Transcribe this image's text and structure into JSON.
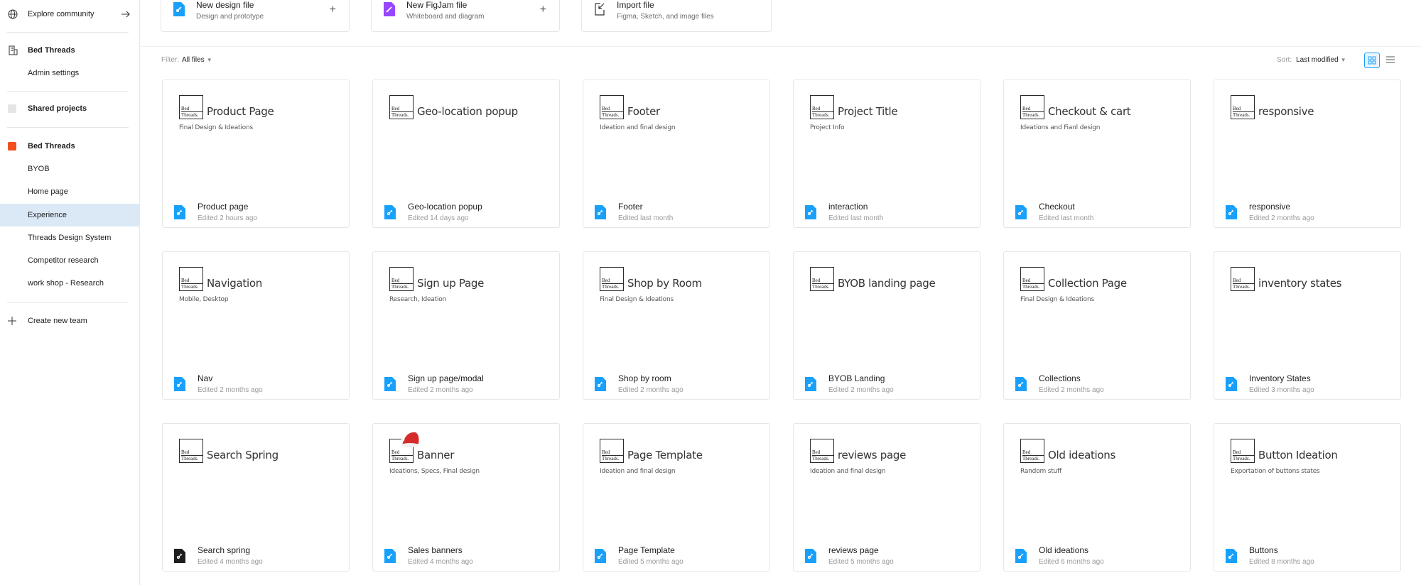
{
  "sidebar": {
    "explore": "Explore community",
    "org_name": "Bed Threads",
    "admin": "Admin settings",
    "shared": "Shared projects",
    "team_name": "Bed Threads",
    "team_color": "#f24e1e",
    "projects": [
      "BYOB",
      "Home page",
      "Experience",
      "Threads Design System",
      "Competitor research",
      "work shop - Research"
    ],
    "active_project": "Experience",
    "create_team": "Create new team"
  },
  "create": [
    {
      "title": "New design file",
      "subtitle": "Design and prototype",
      "icon": "design-file-icon",
      "color": "#18a0fb"
    },
    {
      "title": "New FigJam file",
      "subtitle": "Whiteboard and diagram",
      "icon": "figjam-file-icon",
      "color": "#9747ff"
    },
    {
      "title": "Import file",
      "subtitle": "Figma, Sketch, and image files",
      "icon": "import-icon",
      "color": "#1e1e1e"
    }
  ],
  "filter": {
    "label": "Filter:",
    "value": "All files"
  },
  "sort": {
    "label": "Sort:",
    "value": "Last modified"
  },
  "files": [
    {
      "thumb_title": "Product Page",
      "thumb_sub": "Final Design & Ideations",
      "name": "Product page",
      "meta": "Edited 2 hours ago"
    },
    {
      "thumb_title": "Geo-location popup",
      "thumb_sub": "",
      "name": "Geo-location popup",
      "meta": "Edited 14 days ago"
    },
    {
      "thumb_title": "Footer",
      "thumb_sub": "Ideation and final design",
      "name": "Footer",
      "meta": "Edited last month"
    },
    {
      "thumb_title": "Project Title",
      "thumb_sub": "Project Info",
      "name": "interaction",
      "meta": "Edited last month"
    },
    {
      "thumb_title": "Checkout & cart",
      "thumb_sub": "Ideations and Fianl design",
      "name": "Checkout",
      "meta": "Edited last month"
    },
    {
      "thumb_title": "responsive",
      "thumb_sub": "",
      "name": "responsive",
      "meta": "Edited 2 months ago"
    },
    {
      "thumb_title": "Navigation",
      "thumb_sub": "Mobile, Desktop",
      "name": "Nav",
      "meta": "Edited 2 months ago"
    },
    {
      "thumb_title": "Sign up Page",
      "thumb_sub": "Research, Ideation",
      "name": "Sign up page/modal",
      "meta": "Edited 2 months ago"
    },
    {
      "thumb_title": "Shop by Room",
      "thumb_sub": "Final Design & Ideations",
      "name": "Shop by room",
      "meta": "Edited 2 months ago"
    },
    {
      "thumb_title": "BYOB landing page",
      "thumb_sub": "",
      "name": "BYOB Landing",
      "meta": "Edited 2 months ago"
    },
    {
      "thumb_title": "Collection Page",
      "thumb_sub": "Final Design & Ideations",
      "name": "Collections",
      "meta": "Edited 2 months ago"
    },
    {
      "thumb_title": "inventory states",
      "thumb_sub": "",
      "name": "Inventory States",
      "meta": "Edited 3 months ago"
    },
    {
      "thumb_title": "Search Spring",
      "thumb_sub": "",
      "name": "Search spring",
      "meta": "Edited 4 months ago",
      "dark_icon": true
    },
    {
      "thumb_title": "Banner",
      "thumb_sub": "Ideations, Specs, Final design",
      "name": "Sales banners",
      "meta": "Edited 4 months ago",
      "santa": true
    },
    {
      "thumb_title": "Page Template",
      "thumb_sub": "Ideation and final design",
      "name": "Page Template",
      "meta": "Edited 5 months ago"
    },
    {
      "thumb_title": "reviews page",
      "thumb_sub": "Ideation and final design",
      "name": "reviews page",
      "meta": "Edited 5 months ago"
    },
    {
      "thumb_title": "Old ideations",
      "thumb_sub": "Random stuff",
      "name": "Old ideations",
      "meta": "Edited 6 months ago"
    },
    {
      "thumb_title": "Button Ideation",
      "thumb_sub": "Exportation of buttons states",
      "name": "Buttons",
      "meta": "Edited 8 months ago"
    }
  ],
  "logo_text": [
    "Bed",
    "Threads."
  ]
}
